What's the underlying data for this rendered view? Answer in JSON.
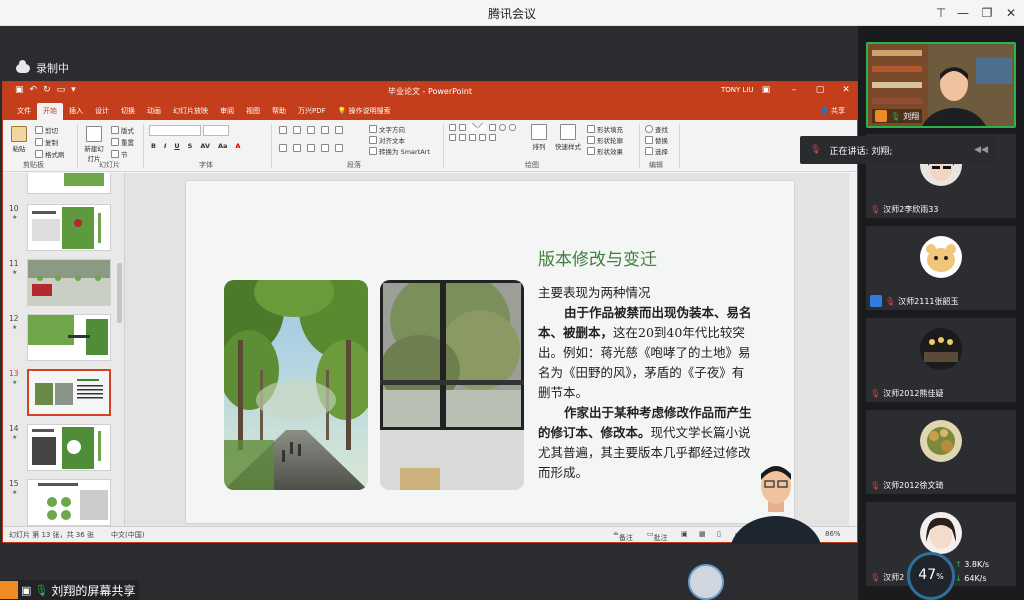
{
  "app": {
    "title": "腾讯会议"
  },
  "window_controls": {
    "pin": "⊤",
    "minimize": "—",
    "restore": "❐",
    "close": "✕"
  },
  "recording": {
    "label": "录制中"
  },
  "ppt": {
    "doc_title": "毕业论文.docx - PowerPoint",
    "doc_title_display": "毕业论文 - PowerPoint",
    "user": "TONY LIU",
    "tabs": [
      "文件",
      "开始",
      "插入",
      "设计",
      "切换",
      "动画",
      "幻灯片放映",
      "审阅",
      "视图",
      "帮助",
      "万兴PDF",
      "操作说明搜索"
    ],
    "active_tab": "开始",
    "share": "共享",
    "ribbon": {
      "groups": [
        "剪贴板",
        "幻灯片",
        "字体",
        "段落",
        "绘图",
        "编辑"
      ],
      "paste": "粘贴",
      "cut": "剪切",
      "copy": "复制",
      "format_painter": "格式刷",
      "new_slide": "新建幻灯片",
      "layout": "版式",
      "reset": "重置",
      "section": "节",
      "text_direction": "文字方向",
      "align_text": "对齐文本",
      "smartart": "转换为 SmartArt",
      "arrange": "排列",
      "quick_styles": "快速样式",
      "shape_fill": "形状填充",
      "shape_outline": "形状轮廓",
      "shape_effects": "形状效果",
      "find": "查找",
      "replace": "替换",
      "select": "选择"
    },
    "slide_numbers": [
      "10",
      "11",
      "12",
      "13",
      "14",
      "15"
    ],
    "slide": {
      "title": "版本修改与变迁",
      "intro": "主要表现为两种情况",
      "p1_bold": "由于作品被禁而出现伪装本、易名本、被删本，",
      "p1_rest": "这在20到40年代比较突出。例如：蒋光慈《咆哮了的土地》易名为《田野的风》，茅盾的《子夜》有删节本。",
      "p2_bold": "作家出于某种考虑修改作品而产生的修订本、修改本。",
      "p2_rest": "现代文学长篇小说尤其普遍，其主要版本几乎都经过修改而形成。"
    },
    "status": {
      "slide_info": "幻灯片 第 13 张，共 36 张",
      "language": "中文(中国)",
      "notes": "备注",
      "comments": "批注",
      "zoom": "86%"
    }
  },
  "speaking": {
    "label": "正在讲话: 刘翔;"
  },
  "participants": [
    {
      "name": "刘翔"
    },
    {
      "name": "汉师2李欣雨33"
    },
    {
      "name": "汉师2111张韶玉"
    },
    {
      "name": "汉师2012熊佳疑"
    },
    {
      "name": "汉师2012徐文琦"
    },
    {
      "name": "汉师2"
    }
  ],
  "bottom": {
    "share_label": "刘翔的屏幕共享"
  },
  "network": {
    "percent": "47",
    "percent_unit": "%",
    "up": "3.8",
    "down": "64",
    "unit": "K/s"
  }
}
